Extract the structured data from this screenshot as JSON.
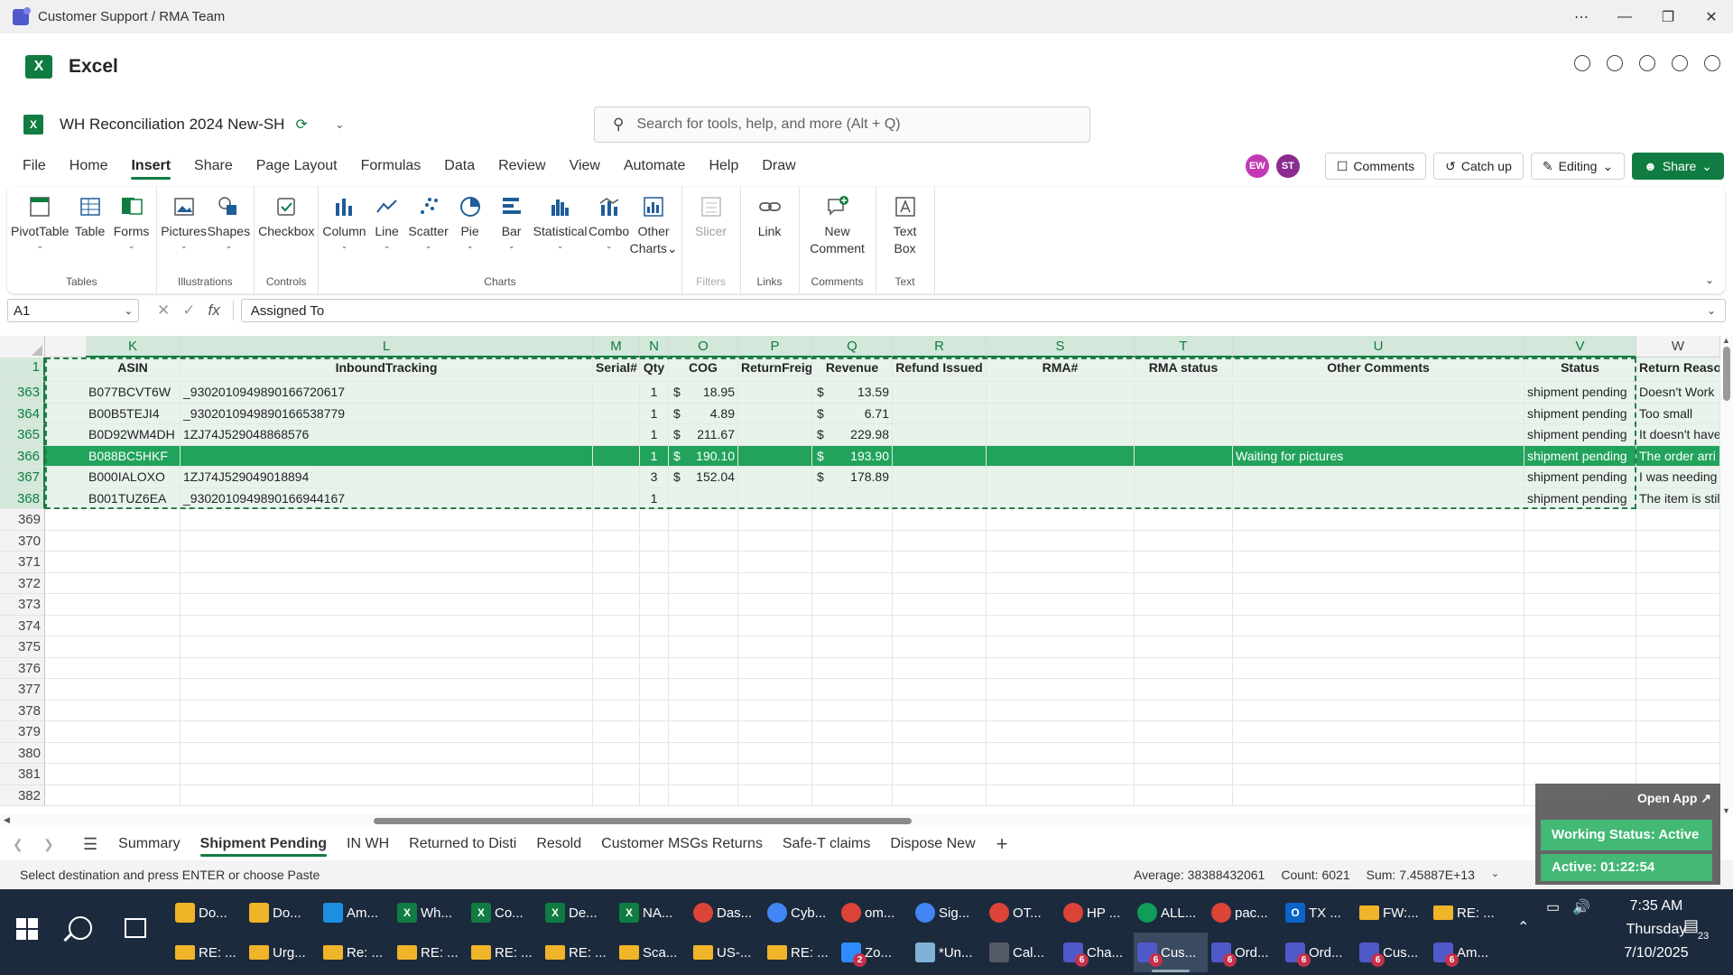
{
  "window": {
    "title": "Customer Support / RMA Team"
  },
  "app": {
    "name": "Excel"
  },
  "doc": {
    "name": "WH Reconciliation 2024 New-SH",
    "search_placeholder": "Search for tools, help, and more (Alt + Q)"
  },
  "menu_tabs": [
    "File",
    "Home",
    "Insert",
    "Share",
    "Page Layout",
    "Formulas",
    "Data",
    "Review",
    "View",
    "Automate",
    "Help",
    "Draw"
  ],
  "active_tab": "Insert",
  "right": {
    "avatar1": "EW",
    "avatar2": "ST",
    "comments": "Comments",
    "catchup": "Catch up",
    "editing": "Editing",
    "share": "Share"
  },
  "ribbon": {
    "tables": {
      "label": "Tables",
      "pivot": "PivotTable",
      "table": "Table",
      "forms": "Forms"
    },
    "illustrations": {
      "label": "Illustrations",
      "pictures": "Pictures",
      "shapes": "Shapes"
    },
    "controls": {
      "label": "Controls",
      "checkbox": "Checkbox"
    },
    "charts": {
      "label": "Charts",
      "column": "Column",
      "line": "Line",
      "scatter": "Scatter",
      "pie": "Pie",
      "bar": "Bar",
      "statistical": "Statistical",
      "combo": "Combo",
      "other1": "Other",
      "other2": "Charts"
    },
    "filters": {
      "label": "Filters",
      "slicer": "Slicer"
    },
    "links": {
      "label": "Links",
      "link": "Link"
    },
    "comments": {
      "label": "Comments",
      "new1": "New",
      "new2": "Comment"
    },
    "text": {
      "label": "Text",
      "tb1": "Text",
      "tb2": "Box"
    }
  },
  "formula": {
    "namebox": "A1",
    "content": "Assigned To"
  },
  "columns": [
    "K",
    "L",
    "M",
    "N",
    "O",
    "P",
    "Q",
    "R",
    "S",
    "T",
    "U",
    "V",
    "W"
  ],
  "header_row": {
    "num": "1",
    "ASIN": "ASIN",
    "InboundTracking": "InboundTracking",
    "Serial": "Serial#",
    "Qty": "Qty",
    "COG": "COG",
    "ReturnFreight": "ReturnFreight",
    "Revenue": "Revenue",
    "Refund": "Refund Issued",
    "RMA": "RMA#",
    "RMAstatus": "RMA status",
    "Other": "Other Comments",
    "Status": "Status",
    "Reason": "Return Reason"
  },
  "rows": [
    {
      "num": "363",
      "asin": "B077BCVT6W",
      "track": "_9302010949890166720617",
      "qty": "1",
      "cog": "18.95",
      "rev": "13.59",
      "other": "",
      "status": "shipment pending",
      "reason": "Doesn't Work"
    },
    {
      "num": "364",
      "asin": "B00B5TEJI4",
      "track": "_9302010949890166538779",
      "qty": "1",
      "cog": "4.89",
      "rev": "6.71",
      "other": "",
      "status": "shipment pending",
      "reason": "Too small"
    },
    {
      "num": "365",
      "asin": "B0D92WM4DH",
      "track": "1ZJ74J529048868576",
      "qty": "1",
      "cog": "211.67",
      "rev": "229.98",
      "other": "",
      "status": "shipment pending",
      "reason": "It doesn't have"
    },
    {
      "num": "366",
      "asin": "B088BC5HKF",
      "track": "",
      "qty": "1",
      "cog": "190.10",
      "rev": "193.90",
      "other": "Waiting for pictures",
      "status": "shipment pending",
      "reason": "The order arri"
    },
    {
      "num": "367",
      "asin": "B000IALOXO",
      "track": "1ZJ74J529049018894",
      "qty": "3",
      "cog": "152.04",
      "rev": "178.89",
      "other": "",
      "status": "shipment pending",
      "reason": "I was needing"
    },
    {
      "num": "368",
      "asin": "B001TUZ6EA",
      "track": "_9302010949890166944167",
      "qty": "1",
      "cog": "",
      "rev": "",
      "other": "",
      "status": "shipment pending",
      "reason": "The item is stil"
    }
  ],
  "dollar": "$",
  "empty_rows": [
    "369",
    "370",
    "371",
    "372",
    "373",
    "374",
    "375",
    "376",
    "377",
    "378",
    "379",
    "380",
    "381",
    "382"
  ],
  "sheets": [
    "Summary",
    "Shipment Pending",
    "IN WH",
    "Returned to Disti",
    "Resold",
    "Customer MSGs Returns",
    "Safe-T claims",
    "Dispose New"
  ],
  "active_sheet": "Shipment Pending",
  "status": {
    "message": "Select destination and press ENTER or choose Paste",
    "average": "Average: 38388432061",
    "count": "Count: 6021",
    "sum": "Sum: 7.45887E+13"
  },
  "popup": {
    "open": "Open App ↗",
    "working": "Working Status: Active",
    "active": "Active: 01:22:54"
  },
  "taskbar_row1": [
    {
      "label": "Do...",
      "color": "#f0b429",
      "icon": "folder-icon"
    },
    {
      "label": "Do...",
      "color": "#f0b429",
      "icon": "folder-icon"
    },
    {
      "label": "Am...",
      "color": "#1d8fe0",
      "icon": "edge-icon"
    },
    {
      "label": "Wh...",
      "color": "#107c41",
      "icon": "excel-icon",
      "glyph": "X"
    },
    {
      "label": "Co...",
      "color": "#107c41",
      "icon": "excel-icon",
      "glyph": "X"
    },
    {
      "label": "De...",
      "color": "#107c41",
      "icon": "excel-icon",
      "glyph": "X"
    },
    {
      "label": "NA...",
      "color": "#107c41",
      "icon": "excel-icon",
      "glyph": "X"
    },
    {
      "label": "Das...",
      "color": "#db4437",
      "icon": "chrome-icon"
    },
    {
      "label": "Cyb...",
      "color": "#4285f4",
      "icon": "chrome-icon"
    },
    {
      "label": "om...",
      "color": "#db4437",
      "icon": "chrome-icon"
    },
    {
      "label": "Sig...",
      "color": "#4285f4",
      "icon": "chrome-icon"
    },
    {
      "label": "OT...",
      "color": "#db4437",
      "icon": "chrome-icon"
    },
    {
      "label": "HP ...",
      "color": "#db4437",
      "icon": "chrome-icon"
    },
    {
      "label": "ALL...",
      "color": "#0f9d58",
      "icon": "chrome-icon"
    },
    {
      "label": "pac...",
      "color": "#db4437",
      "icon": "chrome-icon"
    },
    {
      "label": "TX ...",
      "color": "#0a64c9",
      "icon": "outlook-icon",
      "glyph": "O"
    },
    {
      "label": "FW:...",
      "color": "#f0b429",
      "icon": "mail-icon"
    },
    {
      "label": "RE: ...",
      "color": "#f0b429",
      "icon": "mail-icon"
    }
  ],
  "taskbar_row2": [
    {
      "label": "RE: ...",
      "color": "#f0b429",
      "icon": "mail-icon"
    },
    {
      "label": "Urg...",
      "color": "#f0b429",
      "icon": "mail-icon"
    },
    {
      "label": "Re: ...",
      "color": "#f0b429",
      "icon": "mail-icon"
    },
    {
      "label": "RE: ...",
      "color": "#f0b429",
      "icon": "mail-icon"
    },
    {
      "label": "RE: ...",
      "color": "#f0b429",
      "icon": "mail-icon"
    },
    {
      "label": "RE: ...",
      "color": "#f0b429",
      "icon": "mail-icon"
    },
    {
      "label": "Sca...",
      "color": "#f0b429",
      "icon": "mail-icon"
    },
    {
      "label": "US-...",
      "color": "#f0b429",
      "icon": "mail-icon"
    },
    {
      "label": "RE: ...",
      "color": "#f0b429",
      "icon": "mail-icon"
    },
    {
      "label": "Zo...",
      "color": "#2d8cff",
      "icon": "zoom-icon",
      "badge": "2"
    },
    {
      "label": "*Un...",
      "color": "#7fb3d5",
      "icon": "notepad-icon"
    },
    {
      "label": "Cal...",
      "color": "#555b66",
      "icon": "calculator-icon"
    },
    {
      "label": "Cha...",
      "color": "#5059c9",
      "icon": "teams-icon",
      "badge": "6"
    },
    {
      "label": "Cus...",
      "color": "#5059c9",
      "icon": "teams-icon",
      "badge": "6",
      "active": true
    },
    {
      "label": "Ord...",
      "color": "#5059c9",
      "icon": "teams-icon",
      "badge": "6"
    },
    {
      "label": "Ord...",
      "color": "#5059c9",
      "icon": "teams-icon",
      "badge": "6"
    },
    {
      "label": "Cus...",
      "color": "#5059c9",
      "icon": "teams-icon",
      "badge": "6"
    },
    {
      "label": "Am...",
      "color": "#5059c9",
      "icon": "teams-icon",
      "badge": "6"
    }
  ],
  "clock": {
    "time": "7:35 AM",
    "day": "Thursday",
    "date": "7/10/2025"
  },
  "notif_count": "23",
  "colors": {
    "accent": "#107c41",
    "highlight_row": "#21a35c",
    "taskbar": "#1c2a3d"
  }
}
